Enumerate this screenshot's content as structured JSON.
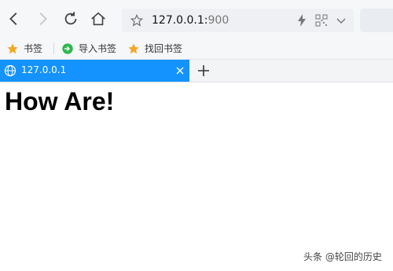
{
  "toolbar": {
    "url_host": "127.0.0.1:",
    "url_port": "900",
    "icons": [
      "back-icon",
      "forward-icon",
      "reload-icon",
      "home-icon",
      "star-icon",
      "bolt-icon",
      "qr-code-icon",
      "chevron-down-icon"
    ]
  },
  "bookmarks": {
    "items": [
      {
        "label": "书签",
        "icon": "star-icon"
      },
      {
        "label": "导入书签",
        "icon": "import-icon"
      },
      {
        "label": "找回书签",
        "icon": "star-icon"
      }
    ]
  },
  "tabs": [
    {
      "title": "127.0.0.1",
      "icon": "globe-icon",
      "active": true
    }
  ],
  "page": {
    "heading": "How Are!"
  },
  "watermark": "头条 @轮回的历史",
  "colors": {
    "tab_active": "#1493ff",
    "star": "#f5a623",
    "import": "#2db84d"
  }
}
